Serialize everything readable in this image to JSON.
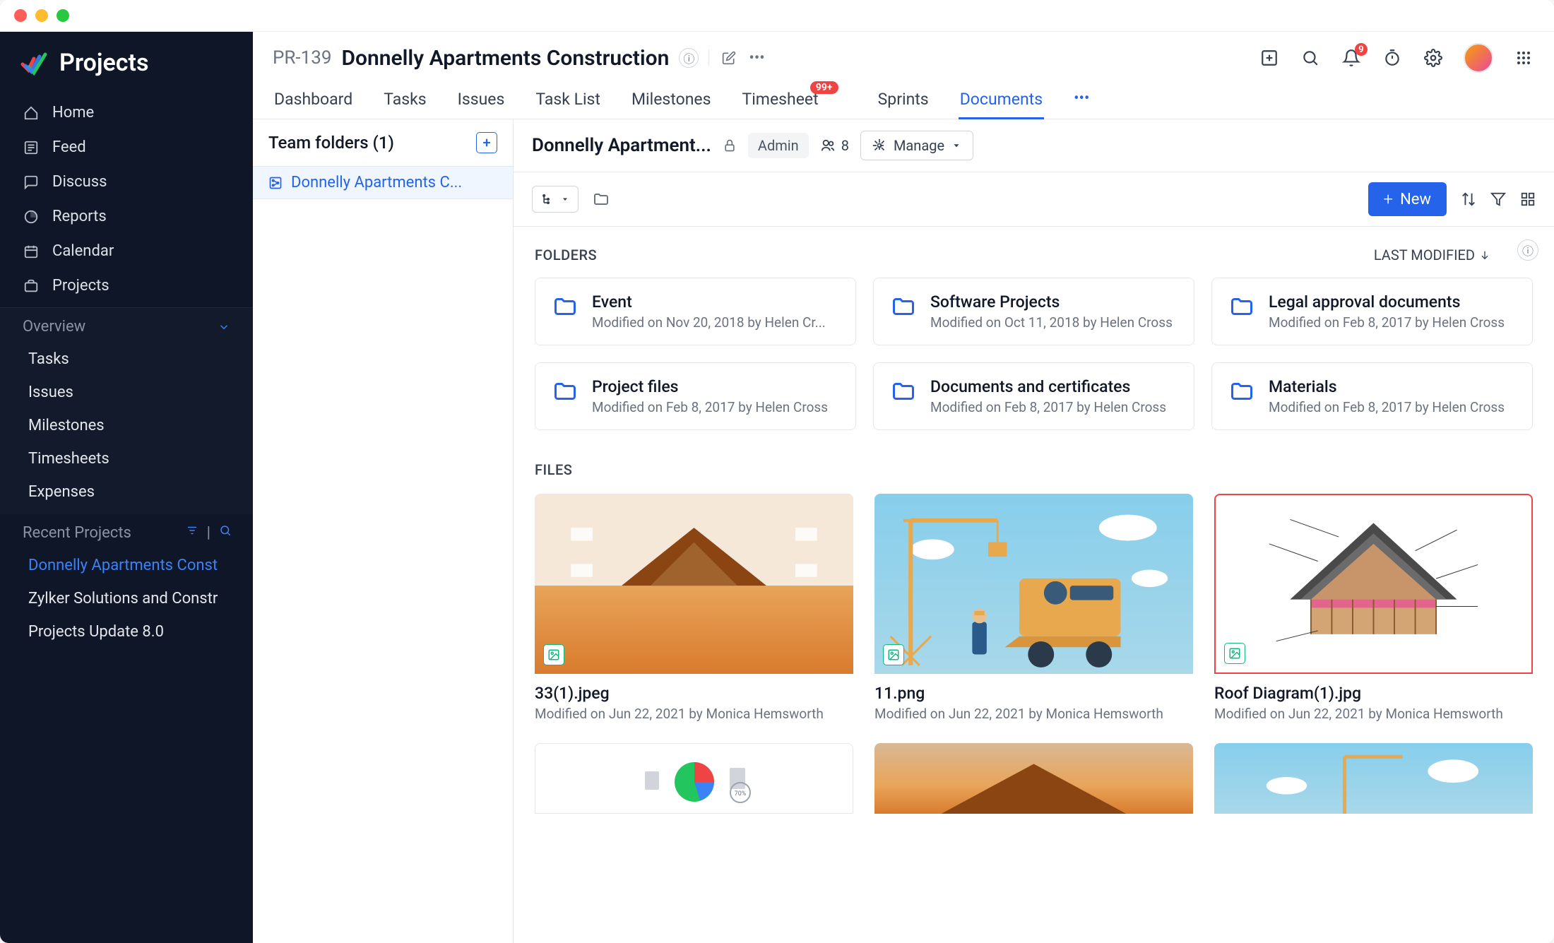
{
  "app_name": "Projects",
  "sidebar": {
    "items": [
      {
        "label": "Home"
      },
      {
        "label": "Feed"
      },
      {
        "label": "Discuss"
      },
      {
        "label": "Reports"
      },
      {
        "label": "Calendar"
      },
      {
        "label": "Projects"
      }
    ],
    "overview_label": "Overview",
    "overview_items": [
      {
        "label": "Tasks"
      },
      {
        "label": "Issues"
      },
      {
        "label": "Milestones"
      },
      {
        "label": "Timesheets"
      },
      {
        "label": "Expenses"
      }
    ],
    "recent_label": "Recent Projects",
    "recent_items": [
      {
        "label": "Donnelly Apartments Const",
        "active": true
      },
      {
        "label": "Zylker Solutions and Constr"
      },
      {
        "label": "Projects Update 8.0"
      }
    ]
  },
  "project": {
    "code": "PR-139",
    "title": "Donnelly Apartments Construction"
  },
  "notifications_badge": "9",
  "tabs": [
    {
      "label": "Dashboard"
    },
    {
      "label": "Tasks"
    },
    {
      "label": "Issues"
    },
    {
      "label": "Task List"
    },
    {
      "label": "Milestones"
    },
    {
      "label": "Timesheet",
      "badge": "99+"
    },
    {
      "label": "Sprints"
    },
    {
      "label": "Documents",
      "active": true
    }
  ],
  "team_folders": {
    "header": "Team folders (1)",
    "items": [
      {
        "label": "Donnelly Apartments C..."
      }
    ]
  },
  "docs": {
    "title": "Donnelly Apartment...",
    "admin_label": "Admin",
    "user_count": "8",
    "manage_label": "Manage",
    "new_label": "New",
    "folders_label": "FOLDERS",
    "sort_label": "LAST MODIFIED",
    "files_label": "FILES",
    "folders": [
      {
        "name": "Event",
        "meta": "Modified on Nov 20, 2018 by Helen Cr..."
      },
      {
        "name": "Software Projects",
        "meta": "Modified on Oct 11, 2018 by Helen Cross"
      },
      {
        "name": "Legal approval documents",
        "meta": "Modified on Feb 8, 2017 by Helen Cross"
      },
      {
        "name": "Project files",
        "meta": "Modified on Feb 8, 2017 by Helen Cross"
      },
      {
        "name": "Documents and certificates",
        "meta": "Modified on Feb 8, 2017 by Helen Cross"
      },
      {
        "name": "Materials",
        "meta": "Modified on Feb 8, 2017 by Helen Cross"
      }
    ],
    "files": [
      {
        "name": "33(1).jpeg",
        "meta": "Modified on Jun 22, 2021 by Monica Hemsworth"
      },
      {
        "name": "11.png",
        "meta": "Modified on Jun 22, 2021 by Monica Hemsworth"
      },
      {
        "name": "Roof Diagram(1).jpg",
        "meta": "Modified on Jun 22, 2021 by Monica Hemsworth"
      }
    ]
  }
}
